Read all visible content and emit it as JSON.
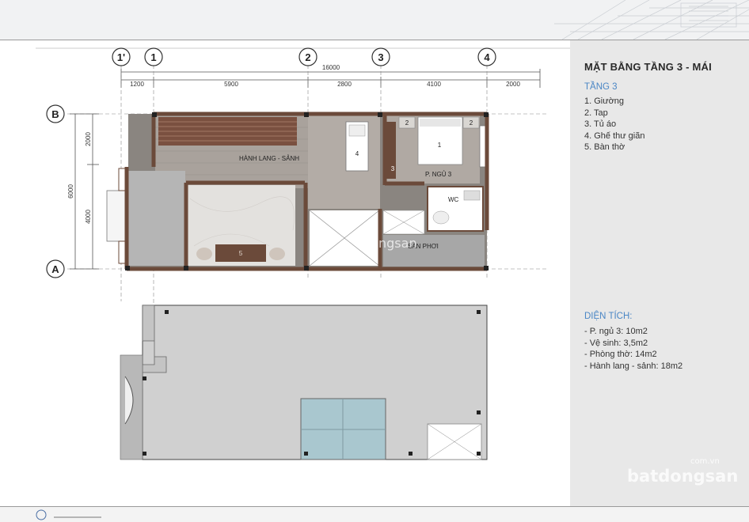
{
  "panel": {
    "title": "MẶT BẰNG TẦNG 3 - MÁI",
    "floor_heading": "TẦNG 3",
    "furniture": [
      "1. Giường",
      "2. Tap",
      "3. Tủ áo",
      "4. Ghế thư giãn",
      "5. Bàn thờ"
    ],
    "area_heading": "DIỆN TÍCH:",
    "areas": [
      "- P. ngủ 3: 10m2",
      "- Vệ sinh: 3,5m2",
      "- Phòng thờ: 14m2",
      "- Hành lang - sảnh: 18m2"
    ]
  },
  "plan": {
    "axes_top": [
      "1'",
      "1",
      "2",
      "3",
      "4"
    ],
    "axes_side": [
      "B",
      "A"
    ],
    "total_dimension": "16000",
    "segment_dimensions": [
      "1200",
      "5900",
      "2800",
      "4100",
      "2000"
    ],
    "side_dimension_total": "6000",
    "side_dimensions": [
      "2000",
      "4000"
    ],
    "room_labels": {
      "hall": "HÀNH LANG - SẢNH",
      "bedroom": "P. NGỦ 3",
      "wc": "WC",
      "deck": "SÀN PHƠI"
    },
    "furniture_numbers": {
      "bed": "1",
      "nightstand_left": "2",
      "nightstand_right": "2",
      "wardrobe": "3",
      "chair": "4",
      "altar": "5"
    }
  },
  "watermark": {
    "text_mid": "ngsan",
    "text_br_small": "com.vn",
    "text_br_big": "batdongsan"
  },
  "colors": {
    "accent_blue": "#4a86c5",
    "wall": "#6b4a3a",
    "floor_wood": "#a8a09a",
    "roof": "#d0d0d0"
  }
}
